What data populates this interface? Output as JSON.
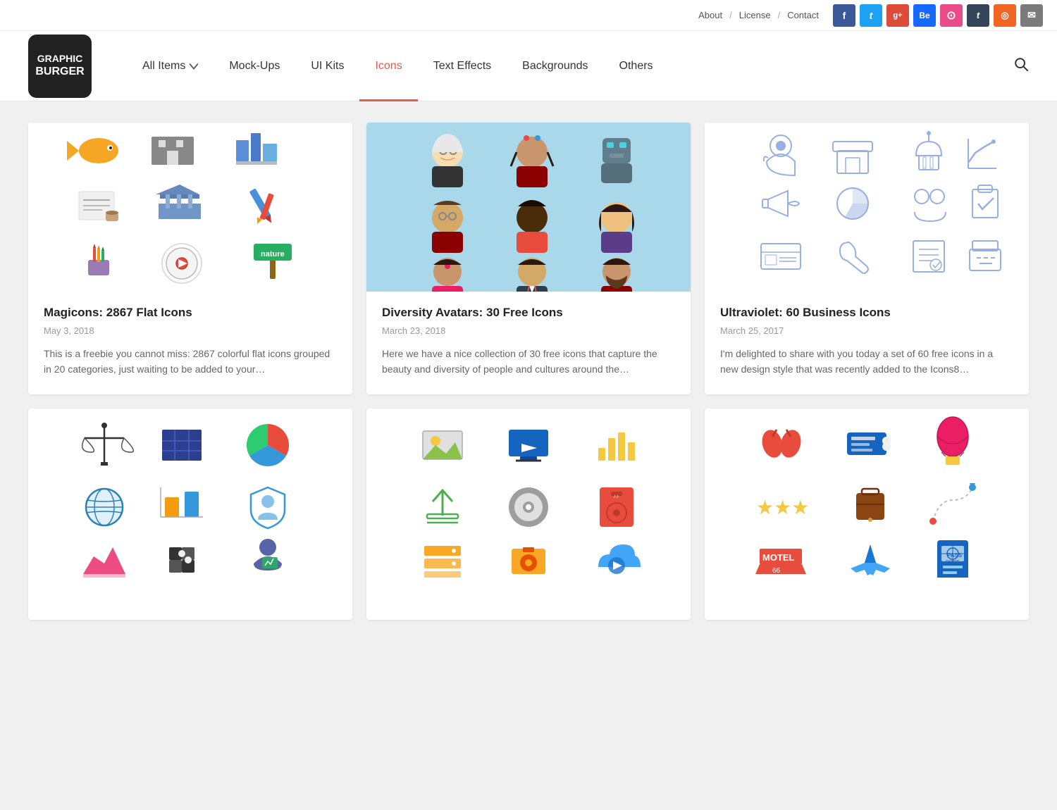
{
  "topbar": {
    "links": [
      "About",
      "License",
      "Contact"
    ],
    "separators": [
      "/",
      "/"
    ],
    "social": [
      {
        "name": "facebook",
        "label": "f",
        "class": "fb"
      },
      {
        "name": "twitter",
        "label": "t",
        "class": "tw"
      },
      {
        "name": "google-plus",
        "label": "g+",
        "class": "gp"
      },
      {
        "name": "behance",
        "label": "Be",
        "class": "be"
      },
      {
        "name": "dribbble",
        "label": "●",
        "class": "dr"
      },
      {
        "name": "tumblr",
        "label": "t",
        "class": "tu"
      },
      {
        "name": "rss",
        "label": "☰",
        "class": "rs"
      },
      {
        "name": "email",
        "label": "✉",
        "class": "em"
      }
    ]
  },
  "logo": {
    "line1": "Graphic",
    "line2": "Burger"
  },
  "nav": {
    "items": [
      {
        "label": "All Items",
        "id": "all-items",
        "active": false,
        "hasDropdown": true
      },
      {
        "label": "Mock-Ups",
        "id": "mockups",
        "active": false,
        "hasDropdown": false
      },
      {
        "label": "UI Kits",
        "id": "ui-kits",
        "active": false,
        "hasDropdown": false
      },
      {
        "label": "Icons",
        "id": "icons",
        "active": true,
        "hasDropdown": false
      },
      {
        "label": "Text Effects",
        "id": "text-effects",
        "active": false,
        "hasDropdown": false
      },
      {
        "label": "Backgrounds",
        "id": "backgrounds",
        "active": false,
        "hasDropdown": false
      },
      {
        "label": "Others",
        "id": "others",
        "active": false,
        "hasDropdown": false
      }
    ]
  },
  "cards": [
    {
      "id": "card-1",
      "title": "Magicons: 2867 Flat Icons",
      "date": "May 3, 2018",
      "description": "This is a freebie you cannot miss: 2867 colorful flat icons grouped in 20 categories, just waiting to be added to your…",
      "image_type": "white"
    },
    {
      "id": "card-2",
      "title": "Diversity Avatars: 30 Free Icons",
      "date": "March 23, 2018",
      "description": "Here we have a nice collection of 30 free icons that capture the beauty and diversity of people and cultures around the…",
      "image_type": "teal"
    },
    {
      "id": "card-3",
      "title": "Ultraviolet: 60 Business Icons",
      "date": "March 25, 2017",
      "description": "I'm delighted to share with you today a set of 60 free icons in a new design style that was recently added to the Icons8…",
      "image_type": "white"
    },
    {
      "id": "card-4",
      "title": "",
      "date": "",
      "description": "",
      "image_type": "white"
    },
    {
      "id": "card-5",
      "title": "",
      "date": "",
      "description": "",
      "image_type": "white"
    },
    {
      "id": "card-6",
      "title": "",
      "date": "",
      "description": "",
      "image_type": "white"
    }
  ]
}
